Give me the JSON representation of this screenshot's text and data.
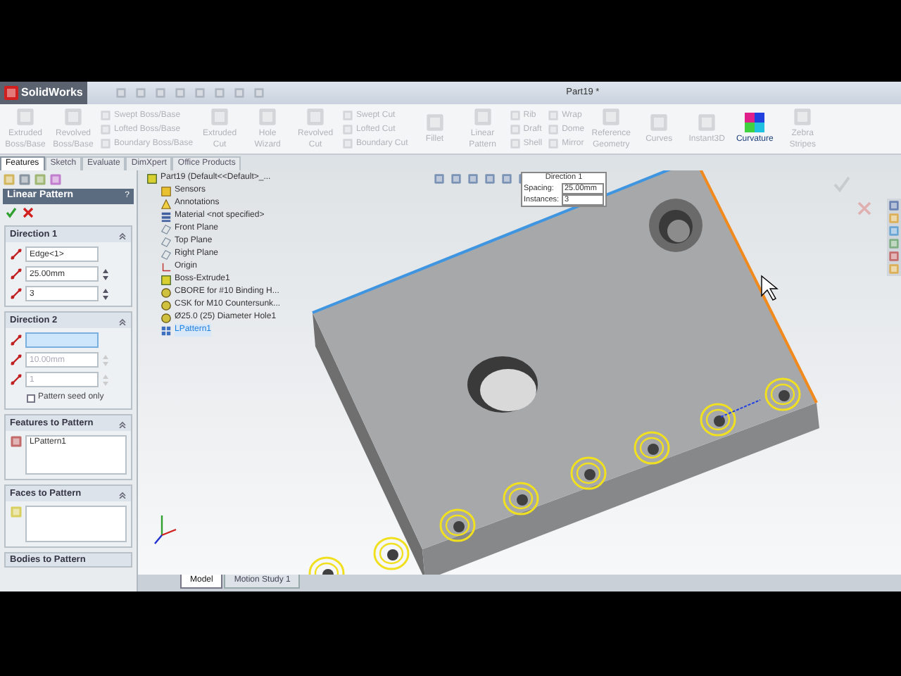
{
  "app": {
    "logo": "SolidWorks",
    "title": "Part19 *"
  },
  "ribbon": [
    {
      "kind": "large",
      "items": [
        {
          "label": "Extruded Boss/Base",
          "disabled": true
        }
      ]
    },
    {
      "kind": "large",
      "items": [
        {
          "label": "Revolved Boss/Base",
          "disabled": true
        }
      ]
    },
    {
      "kind": "stack",
      "items": [
        {
          "label": "Swept Boss/Base",
          "disabled": true
        },
        {
          "label": "Lofted Boss/Base",
          "disabled": true
        },
        {
          "label": "Boundary Boss/Base",
          "disabled": true
        }
      ]
    },
    {
      "kind": "large",
      "items": [
        {
          "label": "Extruded Cut",
          "disabled": true
        }
      ]
    },
    {
      "kind": "large",
      "items": [
        {
          "label": "Hole Wizard",
          "disabled": true
        }
      ]
    },
    {
      "kind": "large",
      "items": [
        {
          "label": "Revolved Cut",
          "disabled": true
        }
      ]
    },
    {
      "kind": "stack",
      "items": [
        {
          "label": "Swept Cut",
          "disabled": true
        },
        {
          "label": "Lofted Cut",
          "disabled": true
        },
        {
          "label": "Boundary Cut",
          "disabled": true
        }
      ]
    },
    {
      "kind": "large",
      "items": [
        {
          "label": "Fillet",
          "disabled": true
        }
      ]
    },
    {
      "kind": "large",
      "items": [
        {
          "label": "Linear Pattern",
          "disabled": true
        }
      ]
    },
    {
      "kind": "stack",
      "items": [
        {
          "label": "Rib",
          "disabled": true
        },
        {
          "label": "Draft",
          "disabled": true
        },
        {
          "label": "Shell",
          "disabled": true
        }
      ]
    },
    {
      "kind": "stack",
      "items": [
        {
          "label": "Wrap",
          "disabled": true
        },
        {
          "label": "Dome",
          "disabled": true
        },
        {
          "label": "Mirror",
          "disabled": true
        }
      ]
    },
    {
      "kind": "large",
      "items": [
        {
          "label": "Reference Geometry",
          "disabled": true
        }
      ]
    },
    {
      "kind": "large",
      "items": [
        {
          "label": "Curves",
          "disabled": true
        }
      ]
    },
    {
      "kind": "large",
      "items": [
        {
          "label": "Instant3D",
          "disabled": true
        }
      ]
    },
    {
      "kind": "large",
      "items": [
        {
          "label": "Curvature",
          "disabled": false
        }
      ]
    },
    {
      "kind": "large",
      "items": [
        {
          "label": "Zebra Stripes",
          "disabled": true
        }
      ]
    }
  ],
  "tabs": [
    {
      "label": "Features",
      "selected": true
    },
    {
      "label": "Sketch",
      "selected": false
    },
    {
      "label": "Evaluate",
      "selected": false
    },
    {
      "label": "DimXpert",
      "selected": false
    },
    {
      "label": "Office Products",
      "selected": false
    }
  ],
  "property_manager": {
    "title": "Linear Pattern",
    "help": "?",
    "direction_1": {
      "title": "Direction 1",
      "edge": {
        "value": "Edge<1>"
      },
      "spacing": {
        "value": "25.00mm",
        "disabled": false
      },
      "instances": {
        "value": "3",
        "disabled": false
      }
    },
    "direction_2": {
      "title": "Direction 2",
      "edge": {
        "active": true
      },
      "spacing": {
        "value": "10.00mm",
        "disabled": true
      },
      "instances": {
        "value": "1",
        "disabled": true
      },
      "seed_only": {
        "label": "Pattern seed only",
        "checked": false
      }
    },
    "features_to_pattern": {
      "title": "Features to Pattern",
      "items": [
        "LPattern1"
      ]
    },
    "faces_to_pattern": {
      "title": "Faces to Pattern"
    },
    "bodies_to_pattern": {
      "title": "Bodies to Pattern"
    }
  },
  "feature_tree": {
    "label": "Part19  (Default<<Default>_...",
    "children": [
      {
        "label": "Sensors",
        "kind": "sensor",
        "selected": false
      },
      {
        "label": "Annotations",
        "kind": "annotation",
        "selected": false
      },
      {
        "label": "Material <not specified>",
        "kind": "material",
        "selected": false
      },
      {
        "label": "Front Plane",
        "kind": "plane",
        "selected": false
      },
      {
        "label": "Top Plane",
        "kind": "plane",
        "selected": false
      },
      {
        "label": "Right Plane",
        "kind": "plane",
        "selected": false
      },
      {
        "label": "Origin",
        "kind": "origin",
        "selected": false
      },
      {
        "label": "Boss-Extrude1",
        "kind": "feature",
        "selected": false
      },
      {
        "label": "CBORE for #10 Binding H...",
        "kind": "hole",
        "selected": false
      },
      {
        "label": "CSK for M10 Countersunk...",
        "kind": "hole",
        "selected": false
      },
      {
        "label": "Ø25.0 (25) Diameter Hole1",
        "kind": "hole",
        "selected": false
      },
      {
        "label": "LPattern1",
        "kind": "pattern",
        "selected": true
      }
    ]
  },
  "callout": {
    "title": "Direction 1",
    "rows": [
      {
        "label": "Spacing:",
        "value": "25.00mm"
      },
      {
        "label": "Instances:",
        "value": "3"
      }
    ]
  },
  "bottom_tabs": [
    {
      "label": "Model",
      "selected": true
    },
    {
      "label": "Motion Study 1",
      "selected": false
    }
  ]
}
